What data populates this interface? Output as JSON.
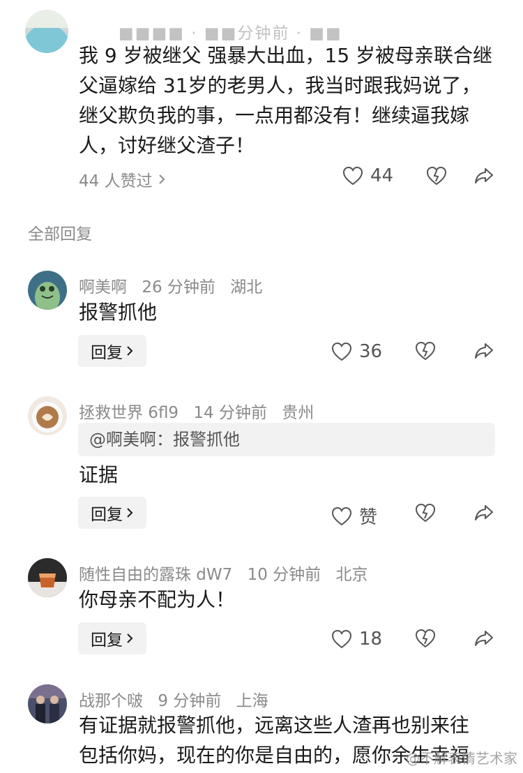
{
  "main_comment": {
    "meta_partial": "■■■■ · ■■分钟前 · ■■",
    "lines": [
      "我 9 岁被继父 强暴大出血，15 岁被母亲联合继",
      "父逼嫁给 31岁的老男人，我当时跟我妈说了，",
      "继父欺负我的事，一点用都没有！继续逼我嫁",
      "人，讨好继父渣子！"
    ],
    "likers": "44 人赞过",
    "like_count": "44"
  },
  "section_title": "全部回复",
  "replies": [
    {
      "name": "啊美啊",
      "time": "26 分钟前",
      "location": "湖北",
      "text": "报警抓他",
      "reply_label": "回复",
      "like_count": "36"
    },
    {
      "name": "拯救世界 6fl9",
      "time": "14 分钟前",
      "location": "贵州",
      "quote": "@啊美啊：报警抓他",
      "text": "证据",
      "reply_label": "回复",
      "like_count": "赞"
    },
    {
      "name": "随性自由的露珠 dW7",
      "time": "10 分钟前",
      "location": "北京",
      "text": "你母亲不配为人！",
      "reply_label": "回复",
      "like_count": "18"
    },
    {
      "name": "战那个啵",
      "time": "9 分钟前",
      "location": "上海",
      "lines": [
        "有证据就报警抓他，远离这些人渣再也别来往",
        "包括你妈，现在的你是自由的，愿你余生幸福"
      ]
    }
  ],
  "watermark": "@不解表情艺术家",
  "icons": {
    "like": "heart-icon",
    "dislike": "broken-heart-icon",
    "share": "share-arrow-icon",
    "chevron": "chevron-right-icon"
  }
}
